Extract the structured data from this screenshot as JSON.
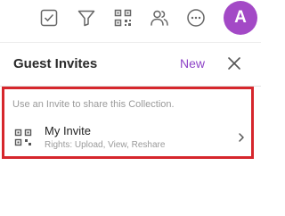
{
  "colors": {
    "accent": "#8e44c7",
    "avatar_bg": "#a349c6",
    "highlight_border": "#d6262c",
    "icon_gray": "#666666"
  },
  "toolbar": {
    "icons": [
      "checkbox-icon",
      "filter-icon",
      "qr-code-icon",
      "users-icon",
      "more-icon"
    ],
    "avatar_letter": "A"
  },
  "panel": {
    "title": "Guest Invites",
    "new_label": "New",
    "hint": "Use an Invite to share this Collection.",
    "invites": [
      {
        "name": "My Invite",
        "rights": "Rights: Upload, View, Reshare"
      }
    ]
  }
}
